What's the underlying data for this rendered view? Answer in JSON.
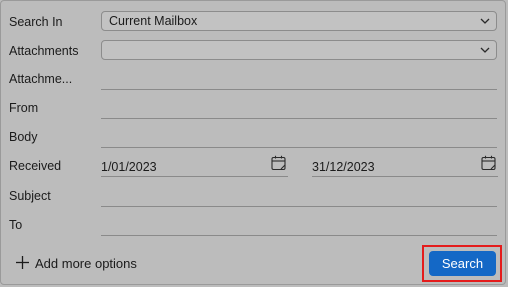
{
  "fields": {
    "search_in": {
      "label": "Search In",
      "value": "Current Mailbox"
    },
    "attachments": {
      "label": "Attachments",
      "value": ""
    },
    "attachment_name": {
      "label": "Attachme...",
      "value": ""
    },
    "from": {
      "label": "From",
      "value": ""
    },
    "body": {
      "label": "Body",
      "value": ""
    },
    "received": {
      "label": "Received",
      "start": "1/01/2023",
      "end": "31/12/2023"
    },
    "subject": {
      "label": "Subject",
      "value": ""
    },
    "to": {
      "label": "To",
      "value": ""
    }
  },
  "actions": {
    "add_more_label": "Add more options",
    "search_label": "Search"
  },
  "colors": {
    "background": "#bcbcbc",
    "accent": "#1468c6",
    "highlight_border": "#e41c1c"
  },
  "icons": {
    "dropdown": "chevron-down-icon",
    "calendar": "calendar-icon",
    "add": "plus-icon"
  }
}
